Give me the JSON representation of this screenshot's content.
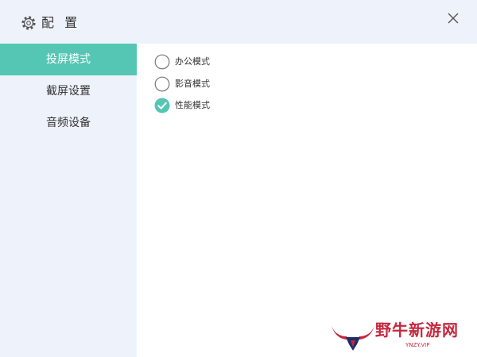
{
  "header": {
    "title": "配 置",
    "settings_icon": "gear-icon",
    "close_icon": "close-icon"
  },
  "sidebar": {
    "items": [
      {
        "label": "投屏模式",
        "active": true
      },
      {
        "label": "截屏设置",
        "active": false
      },
      {
        "label": "音频设备",
        "active": false
      }
    ]
  },
  "main": {
    "options": [
      {
        "label": "办公模式",
        "checked": false
      },
      {
        "label": "影音模式",
        "checked": false
      },
      {
        "label": "性能模式",
        "checked": true
      }
    ]
  },
  "watermark": {
    "text": "野牛新游网",
    "url": "YNZY.VIP"
  },
  "colors": {
    "accent": "#55c6b3",
    "panel_bg": "#eef3fb",
    "watermark": "#c5283d"
  }
}
